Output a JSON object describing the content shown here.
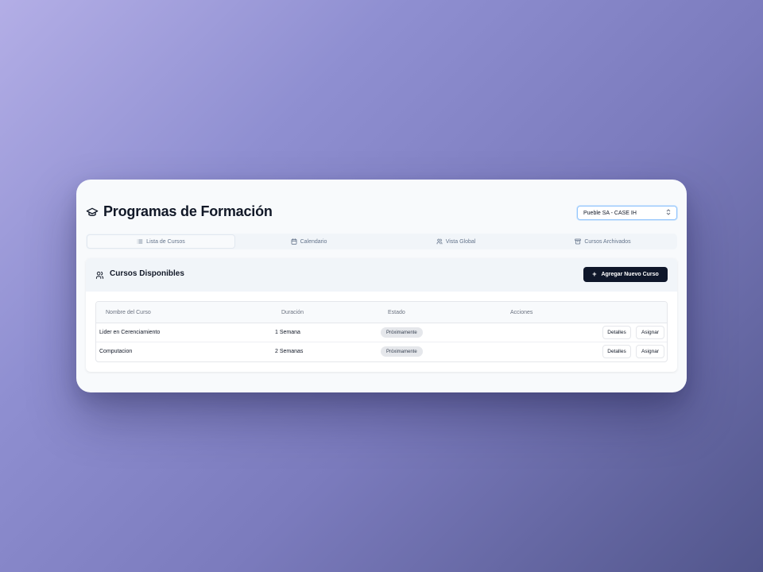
{
  "page": {
    "title": "Programas de Formación",
    "company_select": {
      "value": "Pueble SA - CASE IH"
    }
  },
  "tabs": [
    {
      "label": "Lista de Cursos",
      "icon": "list-icon",
      "active": true
    },
    {
      "label": "Calendario",
      "icon": "calendar-icon",
      "active": false
    },
    {
      "label": "Vista Global",
      "icon": "users-icon",
      "active": false
    },
    {
      "label": "Cursos Archivados",
      "icon": "archive-icon",
      "active": false
    }
  ],
  "courses_card": {
    "title": "Cursos Disponibles",
    "add_button_label": "Agregar Nuevo Curso"
  },
  "table": {
    "columns": [
      "Nombre del Curso",
      "Duración",
      "Estado",
      "Acciones"
    ],
    "rows": [
      {
        "name": "Lider en Cerenciamiento",
        "duration": "1 Semana",
        "status": "Próximamente",
        "details_label": "Detalles",
        "assign_label": "Asignar"
      },
      {
        "name": "Computacion",
        "duration": "2 Semanas",
        "status": "Próximamente",
        "details_label": "Detalles",
        "assign_label": "Asignar"
      }
    ]
  },
  "colors": {
    "accent_dark": "#0f172a",
    "badge_bg": "#e5e7eb",
    "select_border": "#93c5fd"
  }
}
